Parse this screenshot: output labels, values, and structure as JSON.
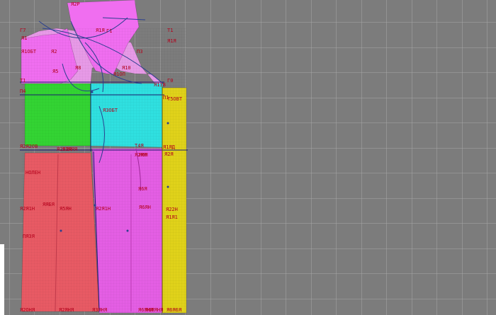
{
  "workspace": {
    "background": "#7c7c7c",
    "grid_color": "#a8a8a8",
    "piece_colors": {
      "yoke": "#f06ef0",
      "back_upper": "#e79ae7",
      "shoulder_green": "#33d433",
      "center_cyan": "#2fe0e0",
      "side_yellow": "#e0d21a",
      "lower_red": "#e85a64",
      "lower_magenta": "#e45ee4"
    },
    "label_color": "#b3001b",
    "curve_color": "#2a3f8f"
  },
  "labels": [
    "Я2Р",
    "Г7",
    "Я1",
    "Я1ОБТ",
    "Я2",
    "Я5",
    "Я8",
    "Т1",
    "П4",
    "Г1",
    "Я1Я",
    "П3",
    "Я10",
    "Я1ОП",
    "Г0",
    "Я1ЗВ",
    "П1",
    "Т1",
    "Т5ОВТ",
    "Я3ОБТ",
    "Я2Я2ОВ",
    "Я25ЯЯ",
    "Я2ЯЯЯ",
    "Т4Я",
    "Я1ЯД",
    "Я2ЯЯ",
    "Я6Я",
    "Я2Я",
    "НОЛЕН",
    "ЯЯБЯ",
    "Я6Я",
    "Я2Я1Н",
    "Я5ЯН",
    "Я2Я1Н",
    "Я6ЯН",
    "Я22Н",
    "Я1Я1",
    "ПЯ3Я",
    "Я2ОНЯ",
    "Я2ЯНЯ",
    "Я3ЯНЯ",
    "Я6ЯНЯ",
    "Я6ЯЯНЯ",
    "Я6Я6Я",
    "Я1Я"
  ]
}
